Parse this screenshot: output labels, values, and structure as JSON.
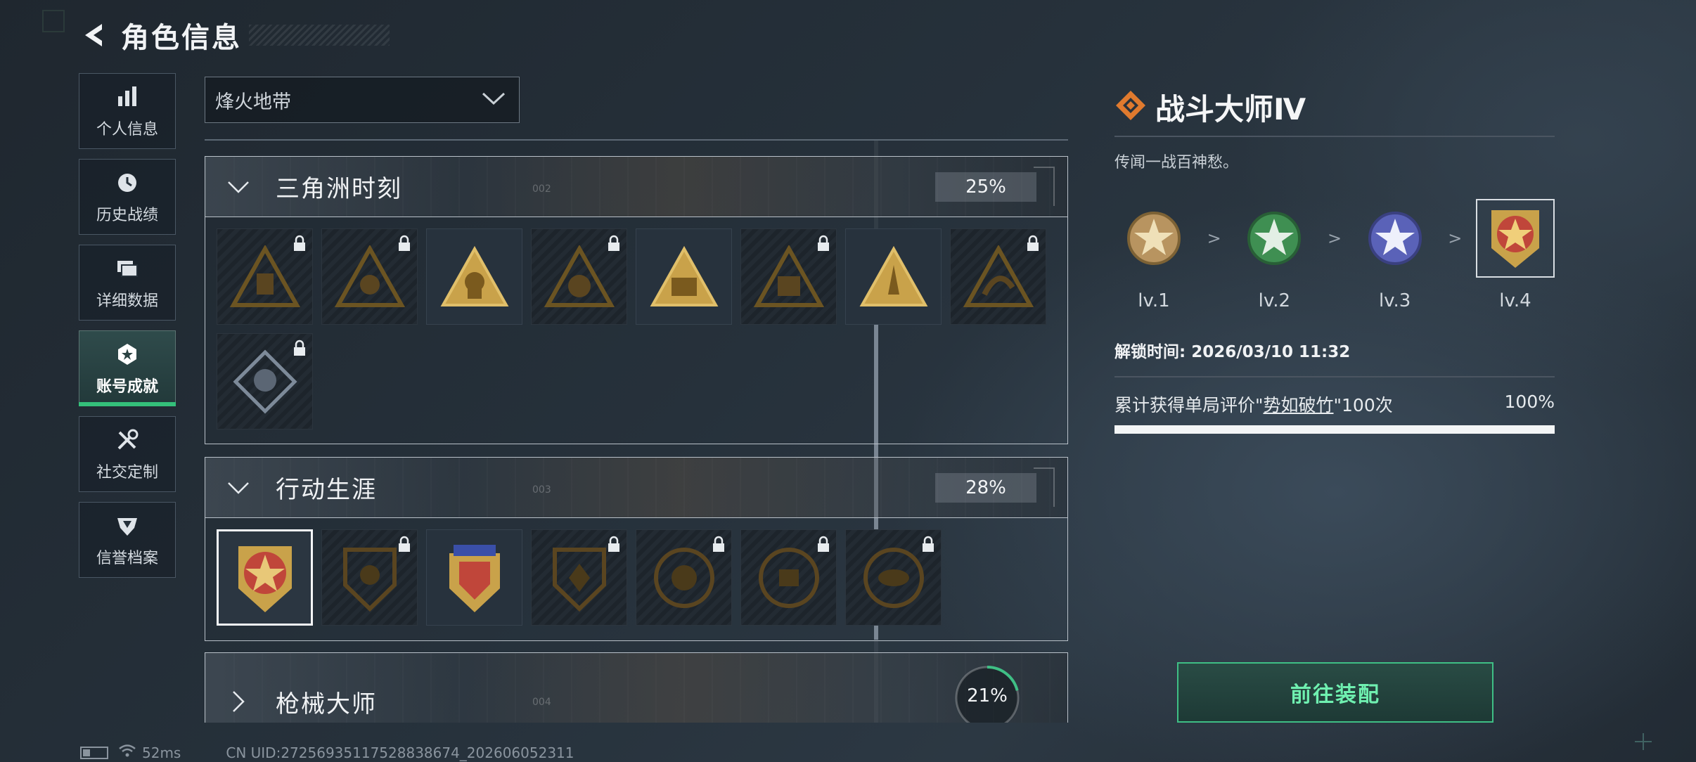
{
  "header": {
    "title": "角色信息",
    "back_icon": "back-arrow-icon"
  },
  "sidebar": {
    "items": [
      {
        "label": "个人信息",
        "icon": "bar-chart-icon",
        "active": false
      },
      {
        "label": "历史战绩",
        "icon": "history-clock-icon",
        "active": false
      },
      {
        "label": "详细数据",
        "icon": "data-folder-icon",
        "active": false
      },
      {
        "label": "账号成就",
        "icon": "achievement-badge-icon",
        "active": true
      },
      {
        "label": "社交定制",
        "icon": "tools-icon",
        "active": false
      },
      {
        "label": "信誉档案",
        "icon": "reputation-shield-icon",
        "active": false
      }
    ]
  },
  "filter": {
    "selected": "烽火地带",
    "icon": "chevron-down-icon"
  },
  "sections": [
    {
      "title": "三角洲时刻",
      "percent": "25%",
      "number": "002",
      "expanded": true,
      "badges": [
        {
          "locked": true
        },
        {
          "locked": true
        },
        {
          "locked": false
        },
        {
          "locked": true
        },
        {
          "locked": false
        },
        {
          "locked": true
        },
        {
          "locked": false
        },
        {
          "locked": true
        },
        {
          "locked": true
        }
      ]
    },
    {
      "title": "行动生涯",
      "percent": "28%",
      "number": "003",
      "expanded": true,
      "badges": [
        {
          "locked": false,
          "selected": true
        },
        {
          "locked": true
        },
        {
          "locked": false
        },
        {
          "locked": true
        },
        {
          "locked": true
        },
        {
          "locked": true
        },
        {
          "locked": true
        }
      ]
    },
    {
      "title": "枪械大师",
      "percent": "21%",
      "number": "004",
      "expanded": false,
      "progress": 0.21
    }
  ],
  "detail": {
    "title": "战斗大师Ⅳ",
    "icon": "diamond-rank-icon",
    "description": "传闻一战百神愁。",
    "levels": [
      {
        "label": "lv.1",
        "color": "#c9a56a"
      },
      {
        "label": "lv.2",
        "color": "#3f8f52"
      },
      {
        "label": "lv.3",
        "color": "#5a62b8"
      },
      {
        "label": "lv.4",
        "color": "#c0463a",
        "current": true
      }
    ],
    "level_separator": ">",
    "unlock_label": "解锁时间: 2026/03/10 11:32",
    "requirement_prefix": "累计获得单局评价\"",
    "requirement_highlight": "势如破竹",
    "requirement_suffix": "\"100次",
    "requirement_percent": "100%",
    "requirement_progress": 1.0
  },
  "equip_button": {
    "label": "前往装配"
  },
  "status_bar": {
    "ping": "52ms",
    "uid": "CN UID:27256935117528838674_202606052311"
  },
  "colors": {
    "accent_green": "#3fbf85",
    "active_underline": "#34c07a",
    "gold": "#c9a24a"
  }
}
